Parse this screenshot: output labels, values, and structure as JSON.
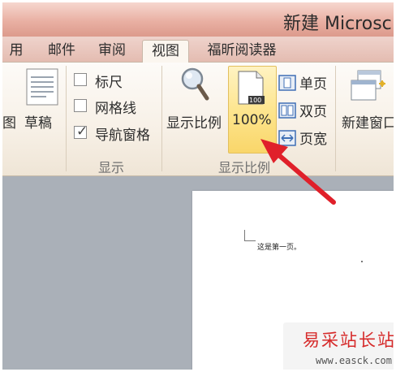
{
  "window": {
    "title": "新建 Microsc"
  },
  "tabs": [
    {
      "label": "用",
      "active": false
    },
    {
      "label": "邮件",
      "active": false
    },
    {
      "label": "审阅",
      "active": false
    },
    {
      "label": "视图",
      "active": true
    },
    {
      "label": "福昕阅读器",
      "active": false
    }
  ],
  "ribbon": {
    "views": {
      "partial_label": "图",
      "draft_label": "草稿"
    },
    "show": {
      "group_label": "显示",
      "ruler": {
        "label": "标尺",
        "checked": false
      },
      "gridlines": {
        "label": "网格线",
        "checked": false
      },
      "nav_pane": {
        "label": "导航窗格",
        "checked": true,
        "check_glyph": "✓"
      }
    },
    "zoom": {
      "group_label": "显示比例",
      "zoom_label": "显示比例",
      "hundred_label": "100%",
      "hundred_icon_text": "100",
      "one_page_label": "单页",
      "two_pages_label": "双页",
      "page_width_label": "页宽"
    },
    "window": {
      "new_window_label": "新建窗口"
    }
  },
  "document": {
    "text": "这是第一页。"
  },
  "watermark": {
    "title": "易采站长站",
    "url": "www.easck.com"
  },
  "colors": {
    "highlight": "#fde48b",
    "arrow": "#e0202a",
    "accent_blue": "#3f6fb5"
  }
}
